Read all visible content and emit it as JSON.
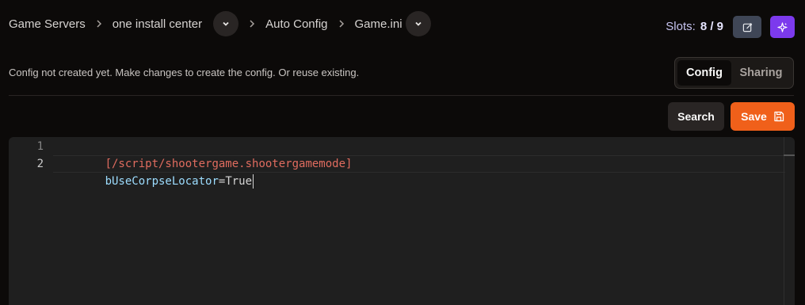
{
  "breadcrumb": {
    "items": [
      "Game Servers",
      "one install center",
      "Auto Config",
      "Game.ini"
    ]
  },
  "slots": {
    "label": "Slots:",
    "value": "8 / 9"
  },
  "notice": "Config not created yet. Make changes to create the config. Or reuse existing.",
  "tabs": [
    {
      "label": "Config",
      "active": true
    },
    {
      "label": "Sharing",
      "active": false
    }
  ],
  "actions": {
    "search": "Search",
    "save": "Save"
  },
  "editor": {
    "lines": [
      {
        "number": "1",
        "section": "[/script/shootergame.shootergamemode]"
      },
      {
        "number": "2",
        "key": "bUseCorpseLocator",
        "eq": "=",
        "value": "True"
      }
    ]
  },
  "colors": {
    "background": "#0c0a09",
    "save": "#f0601a",
    "magic": "#7c3aed",
    "section": "#e06c5f",
    "key": "#9cdcfe"
  },
  "icons": [
    "chevron-right-icon",
    "chevron-down-icon",
    "edit-icon",
    "sparkles-icon",
    "save-icon"
  ]
}
